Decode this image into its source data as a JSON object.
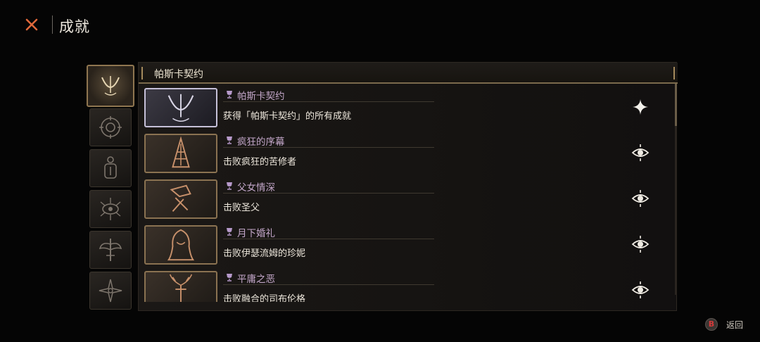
{
  "header": {
    "title": "成就",
    "close_icon": "close-x-icon",
    "accent": "#e0683a"
  },
  "tabs": [
    {
      "icon": "crescent-sigil-icon",
      "active": true
    },
    {
      "icon": "target-rune-icon",
      "active": false
    },
    {
      "icon": "lantern-totem-icon",
      "active": false
    },
    {
      "icon": "thorned-eye-icon",
      "active": false
    },
    {
      "icon": "winged-cross-icon",
      "active": false
    },
    {
      "icon": "star-compass-icon",
      "active": false
    }
  ],
  "panel": {
    "title": "帕斯卡契约"
  },
  "achievements": [
    {
      "name": "帕斯卡契约",
      "desc": "获得「帕斯卡契约」的所有成就",
      "thumb_icon": "crescent-sigil-icon",
      "state_icon": "sparkle-icon",
      "highlight": true
    },
    {
      "name": "疯狂的序幕",
      "desc": "击败疯狂的苦修者",
      "thumb_icon": "spire-creature-icon",
      "state_icon": "locked-eye-icon",
      "highlight": false
    },
    {
      "name": "父女情深",
      "desc": "击败圣父",
      "thumb_icon": "axe-figure-icon",
      "state_icon": "locked-eye-icon",
      "highlight": false
    },
    {
      "name": "月下婚礼",
      "desc": "击败伊瑟流姆的珍妮",
      "thumb_icon": "veiled-bride-icon",
      "state_icon": "locked-eye-icon",
      "highlight": false
    },
    {
      "name": "平庸之恶",
      "desc": "击败融合的司布伦格",
      "thumb_icon": "antlered-beast-icon",
      "state_icon": "locked-eye-icon",
      "highlight": false
    }
  ],
  "footer": {
    "button": "B",
    "label": "返回"
  },
  "colors": {
    "frame_gold": "#8a7251",
    "name_violet": "#c2a6c8",
    "button_red": "#d43a3a"
  }
}
